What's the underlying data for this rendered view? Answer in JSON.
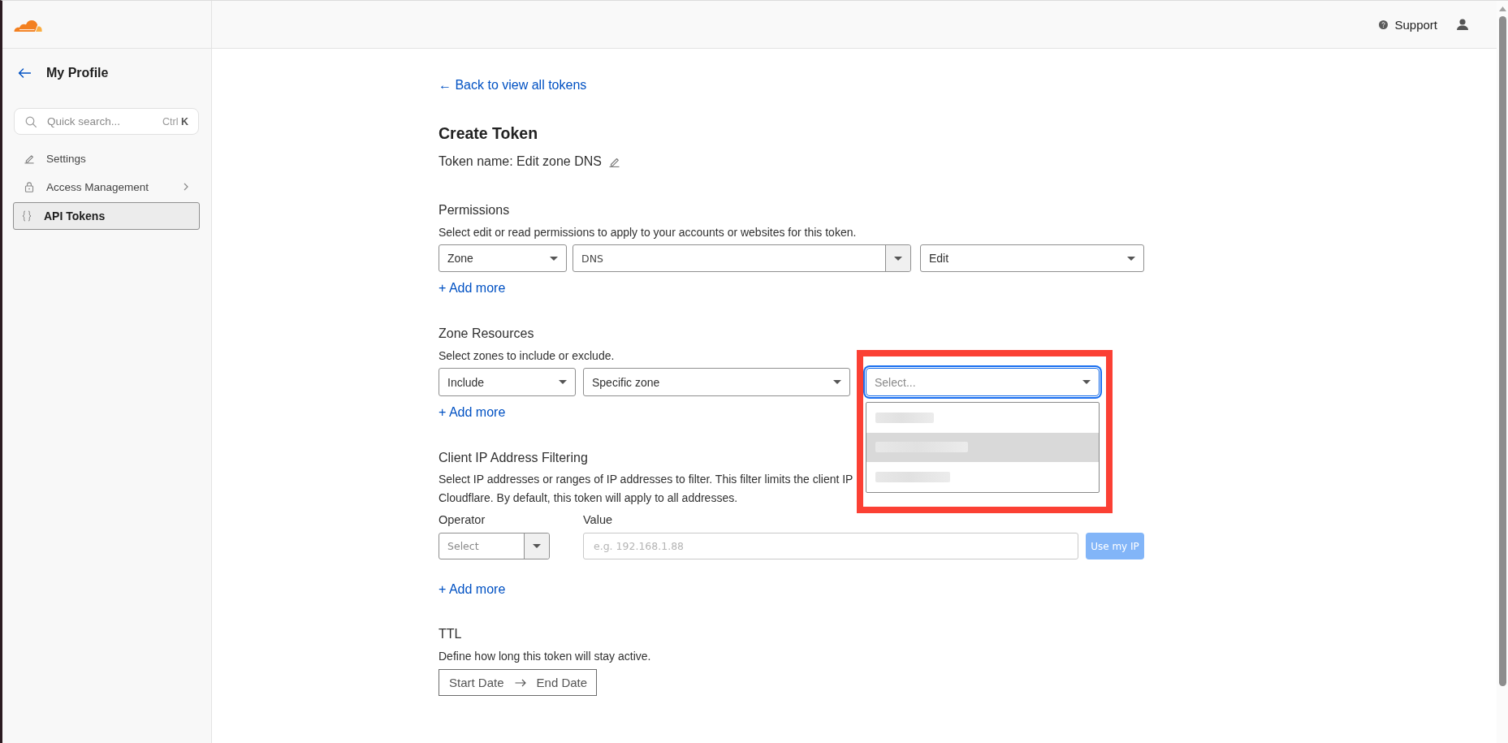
{
  "sidebar": {
    "back_title": "My Profile",
    "search": {
      "placeholder": "Quick search...",
      "shortcut": "Ctrl **K**"
    },
    "items": [
      {
        "label": "Settings",
        "selected": false,
        "has_submenu": false
      },
      {
        "label": "Access Management",
        "selected": false,
        "has_submenu": true
      },
      {
        "label": "API Tokens",
        "selected": true,
        "has_submenu": false
      }
    ]
  },
  "header": {
    "support_link": "Support"
  },
  "back_link": "← Back to view all tokens",
  "title": "Create Token",
  "token_name": "Token name: Edit zone DNS",
  "permissions": {
    "heading": "Permissions",
    "description": "Select edit or read permissions to apply to your accounts or websites for this token.",
    "selects": [
      {
        "kind": "select",
        "value": "Zone"
      },
      {
        "kind": "combobox",
        "value": "DNS"
      },
      {
        "kind": "select",
        "value": "Edit"
      }
    ],
    "add_more": "+ Add more"
  },
  "zone_resources": {
    "heading": "Zone Resources",
    "description": "Select zones to include or exclude.",
    "selects": [
      {
        "kind": "select",
        "value": "Include",
        "focused": false,
        "expanded": false,
        "annotated": false
      },
      {
        "kind": "select",
        "value": "Specific zone",
        "focused": false,
        "expanded": false,
        "annotated": false
      },
      {
        "kind": "select",
        "placeholder": "Select...",
        "focused": true,
        "expanded": true,
        "annotated": true,
        "options": [
          {
            "highlighted": false
          },
          {
            "highlighted": true
          },
          {
            "highlighted": false
          }
        ]
      }
    ],
    "add_more": "+ Add more"
  },
  "ip_filtering": {
    "heading": "Client IP Address Filtering",
    "description_lines": [
      "Select IP addresses or ranges of IP addresses to filter. This filter limits the client IP",
      "Cloudflare. By default, this token will apply to all addresses."
    ],
    "operator": {
      "label": "Operator",
      "kind": "combobox",
      "placeholder": "Select"
    },
    "value": {
      "label": "Value",
      "placeholder": "e.g. 192.168.1.88"
    },
    "use_ip_button": {
      "label": "Use my IP",
      "disabled": true
    },
    "add_more": "+ Add more"
  },
  "ttl": {
    "heading": "TTL",
    "description": "Define how long this token will stay active.",
    "date_range": {
      "start": {
        "placeholder": "Start Date"
      },
      "end": {
        "placeholder": "End Date"
      }
    }
  }
}
